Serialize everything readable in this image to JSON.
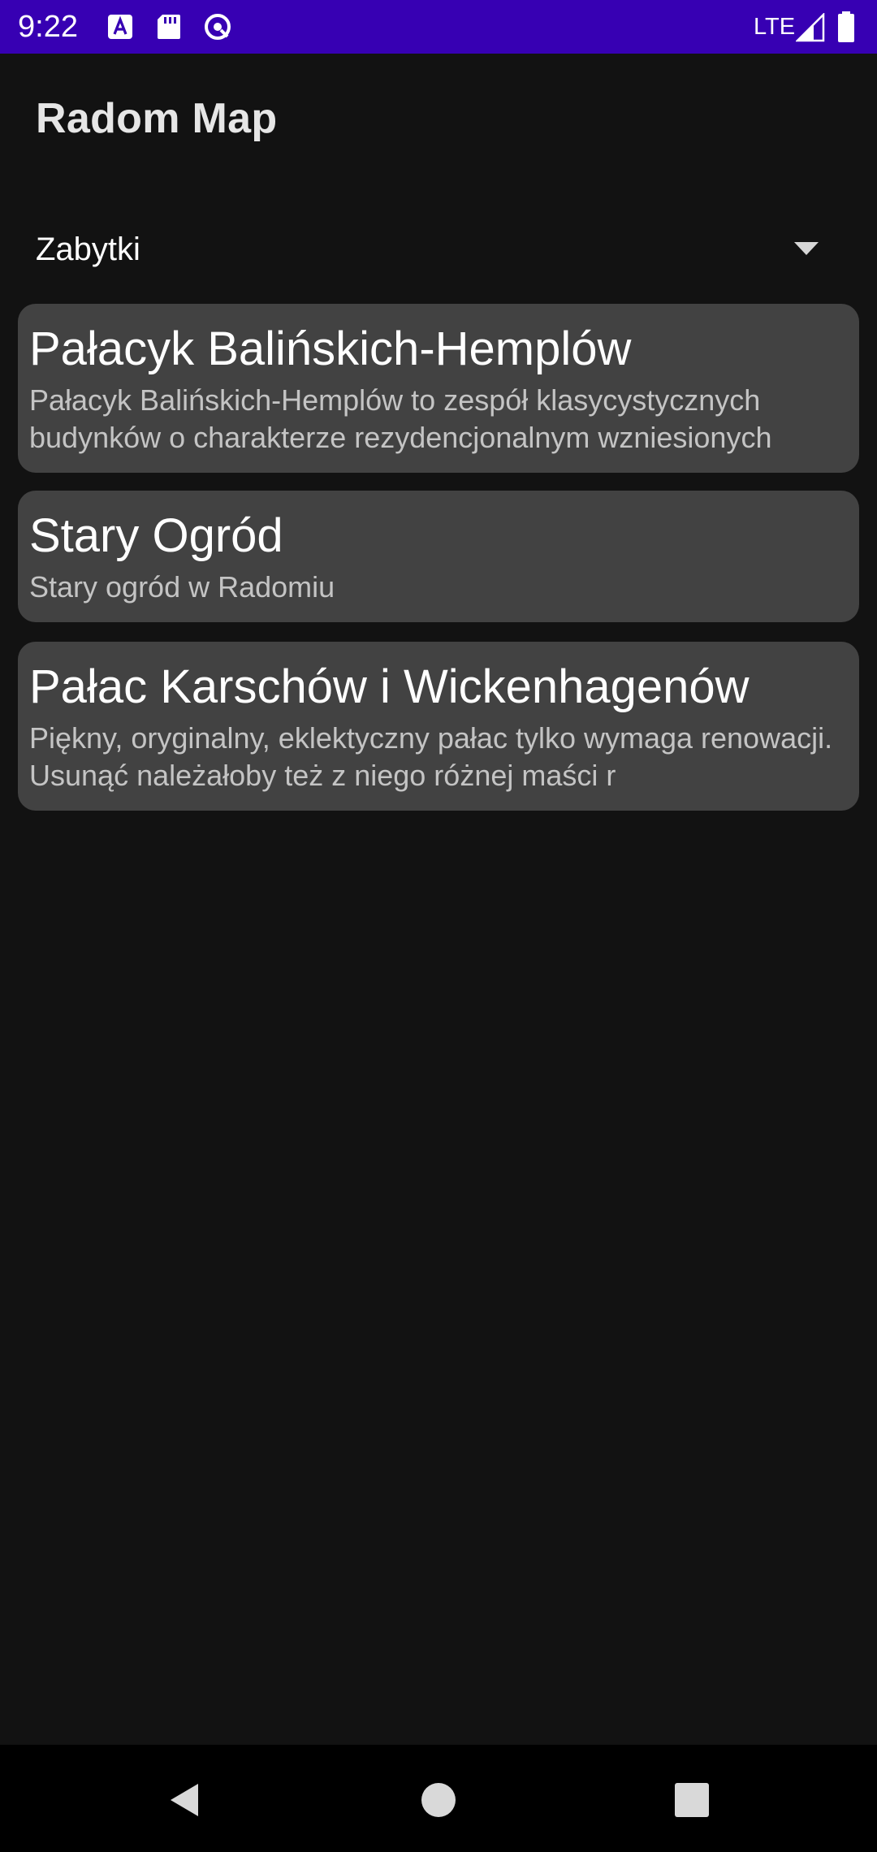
{
  "status_bar": {
    "time": "9:22",
    "network": "LTE",
    "icons": [
      "a-notification-icon",
      "sd-card-icon",
      "no-data-saver-icon",
      "signal-icon",
      "battery-icon"
    ],
    "background_color": "#3700b3"
  },
  "app": {
    "title": "Radom Map"
  },
  "category_spinner": {
    "selected": "Zabytki"
  },
  "places": [
    {
      "name": "Pałacyk Balińskich-Hemplów",
      "description": "Pałacyk Balińskich-Hemplów to zespół klasycystycznych budynków o charakterze rezydencjonalnym wzniesionych"
    },
    {
      "name": "Stary Ogród",
      "description": "Stary ogród w Radomiu"
    },
    {
      "name": "Pałac Karschów i Wickenhagenów",
      "description": "Piękny, oryginalny, eklektyczny pałac tylko wymaga renowacji. Usunąć należałoby też z niego różnej maści r"
    }
  ],
  "nav_bar": {
    "buttons": [
      "back-icon",
      "home-icon",
      "recents-icon"
    ]
  },
  "colors": {
    "background": "#121212",
    "card": "#424242",
    "title_text": "#ffffff",
    "secondary_text": "#c4c4c4"
  }
}
